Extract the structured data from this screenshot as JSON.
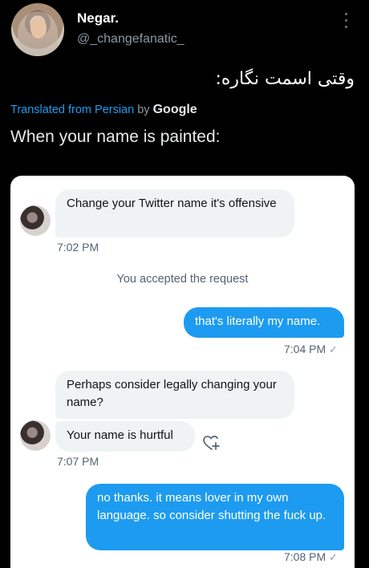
{
  "tweet": {
    "display_name": "Negar.",
    "handle": "@_changefanatic_",
    "original_text": "وقتی اسمت نگاره:",
    "translated_from": "Translated from Persian",
    "translated_by": "by",
    "translator": "Google",
    "translation": "When your name is painted:"
  },
  "dm": {
    "msg1": "Change your Twitter name it's offensive",
    "time1": "7:02 PM",
    "system_note": "You accepted the request",
    "msg2": "that's literally my name.",
    "time2": "7:04 PM",
    "msg3": "Perhaps consider legally changing your name?",
    "msg4": "Your name is hurtful",
    "time3": "7:07 PM",
    "msg5": "no thanks. it means lover in my own language. so consider shutting the fuck up.",
    "time4": "7:08 PM",
    "check_glyph": "✓"
  },
  "colors": {
    "accent": "#1d9bf0",
    "incoming_bubble": "#eff3f4",
    "background": "#000000"
  },
  "icons": [
    "more-vertical-icon",
    "add-reaction-heart-icon",
    "sent-check-icon"
  ]
}
